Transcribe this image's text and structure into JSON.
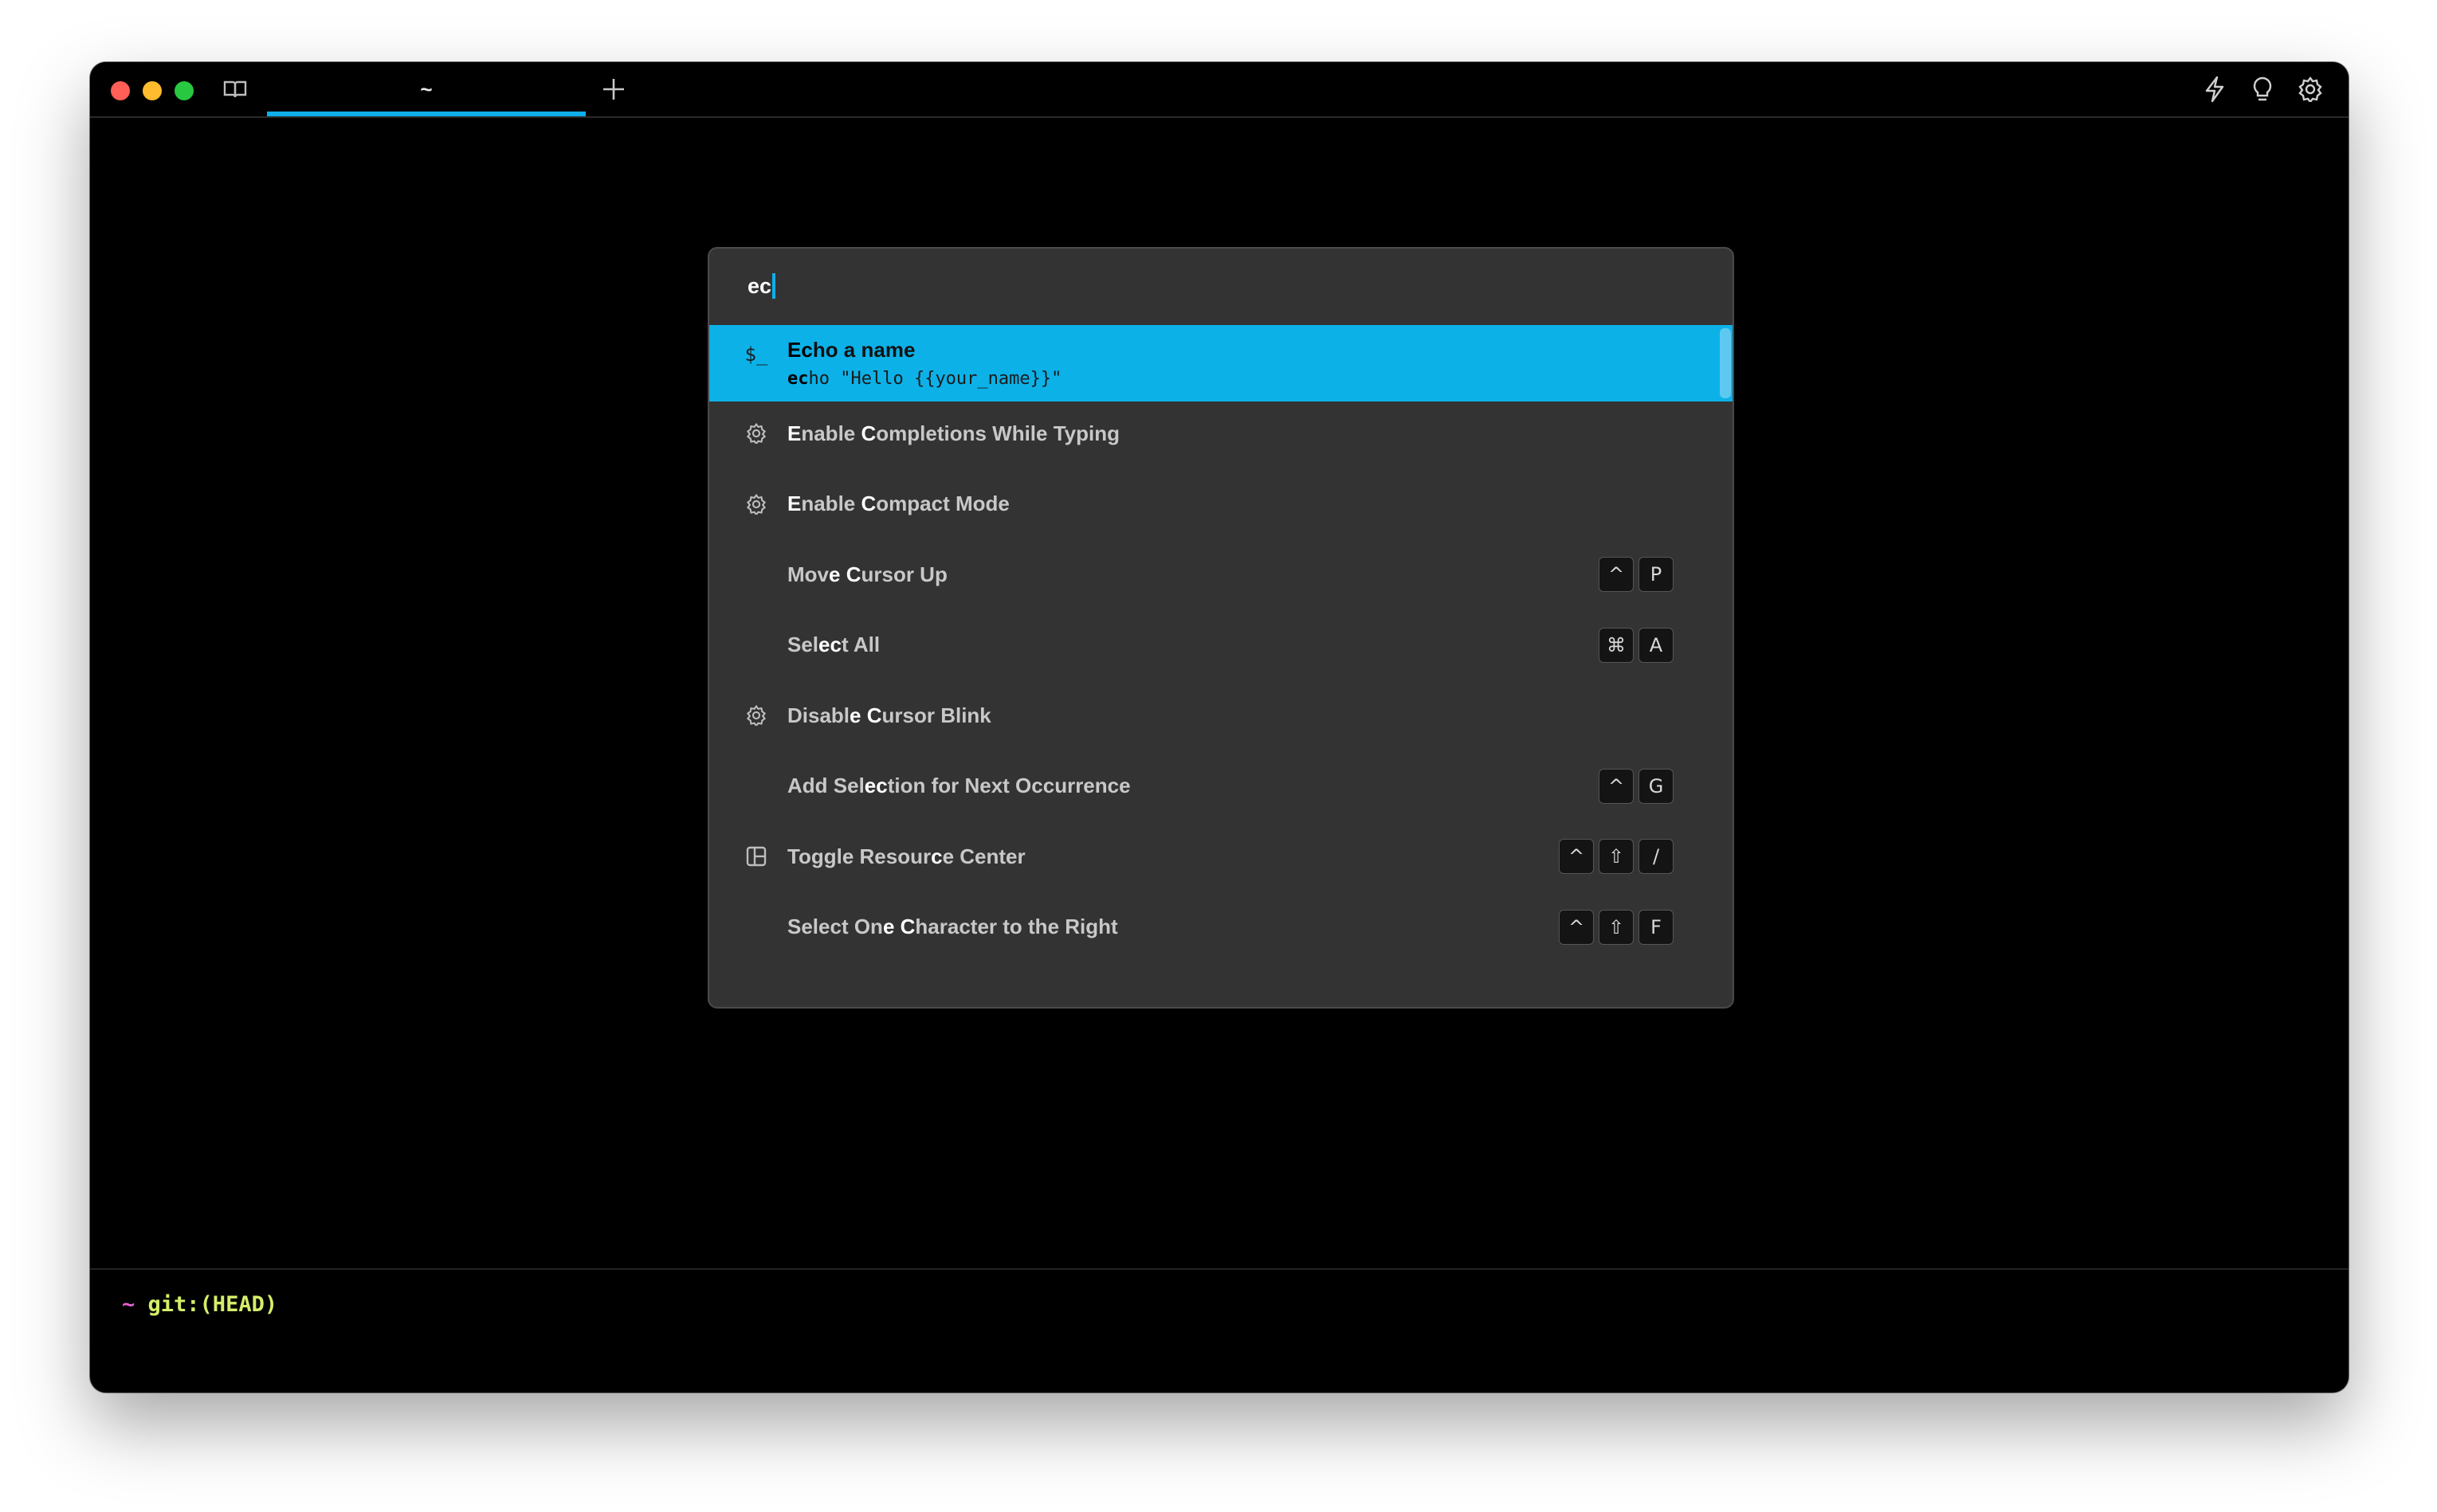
{
  "window": {
    "tab_title": "~",
    "icons": {
      "sidebar": "book-icon",
      "new_tab": "plus-icon",
      "right": [
        "bolt-icon",
        "lightbulb-icon",
        "gear-icon"
      ]
    }
  },
  "palette": {
    "query": "ec",
    "items": [
      {
        "icon": "$_",
        "title_parts": [
          [
            "Ec",
            true
          ],
          [
            "ho a name",
            false
          ]
        ],
        "sub_parts": [
          [
            "ec",
            true
          ],
          [
            "ho \"Hello {{your_name}}\"",
            false
          ]
        ],
        "keys": [],
        "selected": true
      },
      {
        "icon": "gear-icon",
        "title_parts": [
          [
            "E",
            true
          ],
          [
            "nable ",
            false
          ],
          [
            "C",
            true
          ],
          [
            "ompletions While Typing",
            false
          ]
        ],
        "keys": []
      },
      {
        "icon": "gear-icon",
        "title_parts": [
          [
            "E",
            true
          ],
          [
            "nable ",
            false
          ],
          [
            "C",
            true
          ],
          [
            "ompact Mode",
            false
          ]
        ],
        "keys": []
      },
      {
        "icon": "",
        "title_parts": [
          [
            "Mov",
            false
          ],
          [
            "e",
            true
          ],
          [
            " ",
            false
          ],
          [
            "C",
            true
          ],
          [
            "ursor Up",
            false
          ]
        ],
        "keys": [
          "^",
          "P"
        ]
      },
      {
        "icon": "",
        "title_parts": [
          [
            "Sel",
            false
          ],
          [
            "ec",
            true
          ],
          [
            "t All",
            false
          ]
        ],
        "keys": [
          "⌘",
          "A"
        ]
      },
      {
        "icon": "gear-icon",
        "title_parts": [
          [
            "Disabl",
            false
          ],
          [
            "e",
            true
          ],
          [
            " ",
            false
          ],
          [
            "C",
            true
          ],
          [
            "ursor Blink",
            false
          ]
        ],
        "keys": []
      },
      {
        "icon": "",
        "title_parts": [
          [
            "Add Sel",
            false
          ],
          [
            "ec",
            true
          ],
          [
            "tion for Next Occurrence",
            false
          ]
        ],
        "keys": [
          "^",
          "G"
        ]
      },
      {
        "icon": "panel-icon",
        "title_parts": [
          [
            "Toggle Resour",
            false
          ],
          [
            "c",
            true
          ],
          [
            "e Center",
            false
          ]
        ],
        "keys": [
          "^",
          "⇧",
          "/"
        ]
      },
      {
        "icon": "",
        "title_parts": [
          [
            "Select On",
            false
          ],
          [
            "e",
            true
          ],
          [
            " ",
            false
          ],
          [
            "C",
            true
          ],
          [
            "haracter to the Right",
            false
          ]
        ],
        "keys": [
          "^",
          "⇧",
          "F"
        ]
      }
    ]
  },
  "prompt": {
    "tilde": "~",
    "git": "git:(HEAD)"
  },
  "colors": {
    "accent": "#0cb1e8",
    "palette_bg": "#333333",
    "terminal_bg": "#000000",
    "prompt_tilde": "#e55fd2",
    "prompt_git": "#d4ee6a"
  }
}
